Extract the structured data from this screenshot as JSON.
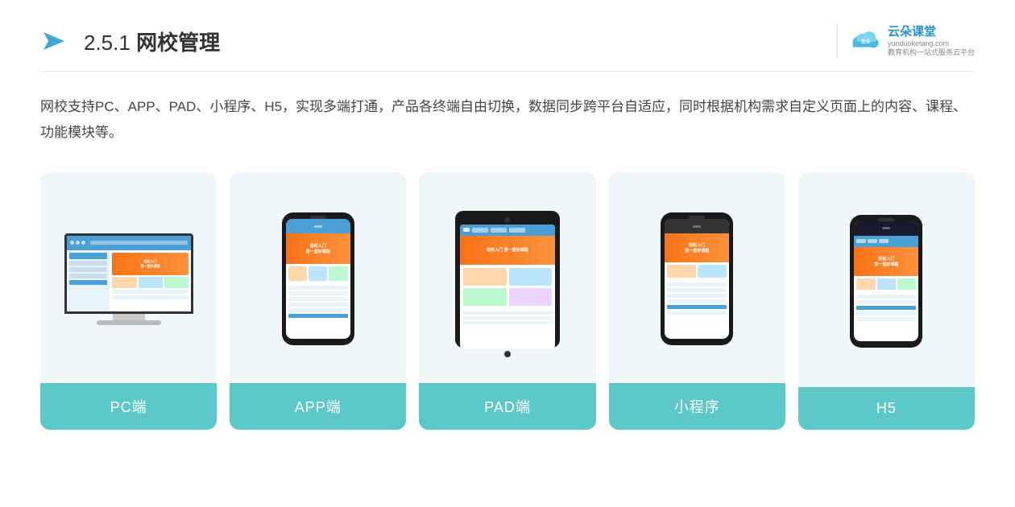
{
  "header": {
    "section_number": "2.5.1",
    "title_normal": "2.5.1 ",
    "title_bold": "网校管理",
    "brand": {
      "name_cn": "云朵课堂",
      "name_en": "yunduoketang.com",
      "slogan": "教育机构一站\n式服务云平台"
    }
  },
  "description": {
    "text": "网校支持PC、APP、PAD、小程序、H5，实现多端打通，产品各终端自由切换，数据同步跨平台自适应，同时根据机构需求自定义页面上的内容、课程、功能模块等。"
  },
  "cards": [
    {
      "label": "PC端"
    },
    {
      "label": "APP端"
    },
    {
      "label": "PAD端"
    },
    {
      "label": "小程序"
    },
    {
      "label": "H5"
    }
  ],
  "colors": {
    "card_bg": "#f0f7fb",
    "card_label_bg": "#5cc8c8",
    "accent": "#4a9fd4",
    "hero_orange": "#f97316"
  }
}
